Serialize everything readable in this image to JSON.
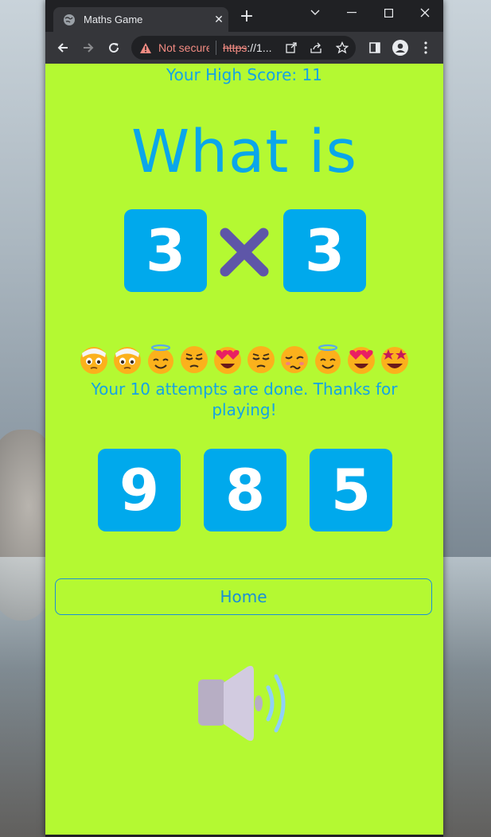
{
  "browser": {
    "tab_title": "Maths Game",
    "tab_close": "✕",
    "new_tab": "+",
    "not_secure": "Not secure",
    "url_scheme": "https",
    "url_rest": "://1..."
  },
  "game": {
    "high_score_text": "Your High Score: 11",
    "question_label": "What is",
    "operand_left": "3",
    "operator": "multiply",
    "operand_right": "3",
    "attempt_emojis": [
      "bandage",
      "bandage",
      "halo",
      "unamused",
      "heart-eyes",
      "unamused",
      "woozy",
      "halo",
      "heart-eyes",
      "star-struck"
    ],
    "message": "Your 10 attempts are done. Thanks for playing!",
    "choices": [
      "9",
      "8",
      "5"
    ],
    "home_label": "Home",
    "sound_icon": "speaker-volume-icon"
  },
  "colors": {
    "page_bg": "#b4f932",
    "tile_bg": "#00a9ec",
    "text_blue": "#15a3e4",
    "operator": "#5e56a8"
  }
}
